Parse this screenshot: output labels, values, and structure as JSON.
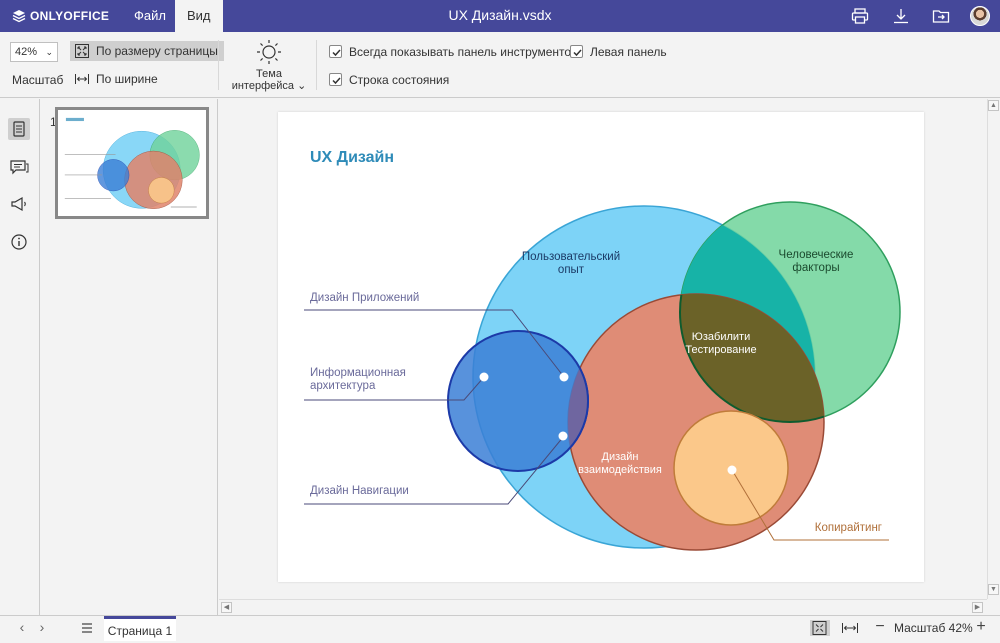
{
  "header": {
    "brand": "ONLYOFFICE",
    "tabs": [
      {
        "label": "Файл",
        "active": false
      },
      {
        "label": "Вид",
        "active": true
      }
    ],
    "title": "UX Дизайн.vsdx",
    "icons": [
      "print-icon",
      "download-icon",
      "open-location-icon",
      "user-avatar"
    ],
    "color": "#45489a"
  },
  "toolbar": {
    "zoom_value": "42%",
    "zoom_label": "Масштаб",
    "fit_page_label": "По размеру страницы",
    "fit_width_label": "По ширине",
    "theme_label_line1": "Тема",
    "theme_label_line2": "интерфейса",
    "checkboxes": {
      "always_show_toolbar": {
        "label": "Всегда показывать панель инструментов",
        "checked": true
      },
      "left_panel": {
        "label": "Левая панель",
        "checked": true
      },
      "status_bar": {
        "label": "Строка состояния",
        "checked": true
      }
    }
  },
  "sidebar": {
    "icons": [
      "thumbnails-icon",
      "comments-icon",
      "feedback-icon",
      "about-icon"
    ]
  },
  "thumbnails": {
    "items": [
      {
        "number": "1",
        "selected": true
      }
    ]
  },
  "diagram": {
    "title": "UX Дизайн",
    "circle_labels": {
      "user_experience_1": "Пользовательский",
      "user_experience_2": "опыт",
      "human_factors_1": "Человеческие",
      "human_factors_2": "факторы",
      "usability_1": "Юзабилити",
      "usability_2": "Тестирование",
      "interaction_1": "Дизайн",
      "interaction_2": "взаимодействия"
    },
    "callouts": {
      "app_design": "Дизайн Приложений",
      "info_arch_1": "Информационная",
      "info_arch_2": "архитектура",
      "nav_design": "Дизайн Навигации",
      "copywriting": "Копирайтинг"
    },
    "colors": {
      "title": "#2e8bb8",
      "user_experience": "#7dd3f7",
      "human_factors": "#6fd39a",
      "interaction": "#e0846c",
      "info_arch": "#3b7fd6",
      "copywriting": "#fbc88a",
      "usability": "#6d5e2a"
    }
  },
  "statusbar": {
    "page_tab": "Страница 1",
    "zoom_label": "Масштаб 42%"
  }
}
